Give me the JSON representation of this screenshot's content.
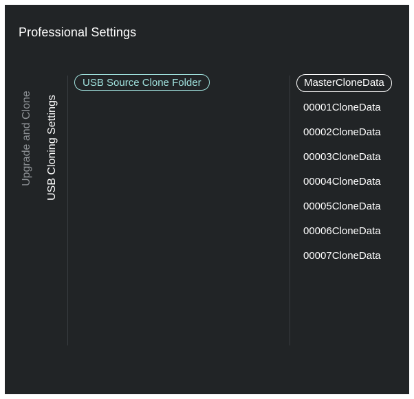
{
  "header": {
    "title": "Professional Settings"
  },
  "nav": {
    "parent_label": "Upgrade and Clone",
    "current_label": "USB Cloning Settings"
  },
  "menu": {
    "items": [
      {
        "label": "USB Source Clone Folder",
        "state": "focused"
      }
    ]
  },
  "folder_list": {
    "selected_index": 0,
    "items": [
      {
        "label": "MasterCloneData"
      },
      {
        "label": "00001CloneData"
      },
      {
        "label": "00002CloneData"
      },
      {
        "label": "00003CloneData"
      },
      {
        "label": "00004CloneData"
      },
      {
        "label": "00005CloneData"
      },
      {
        "label": "00006CloneData"
      },
      {
        "label": "00007CloneData"
      }
    ]
  },
  "colors": {
    "background": "#212426",
    "accent": "#9fe0dc",
    "text": "#ffffff",
    "muted": "#8e9296"
  }
}
